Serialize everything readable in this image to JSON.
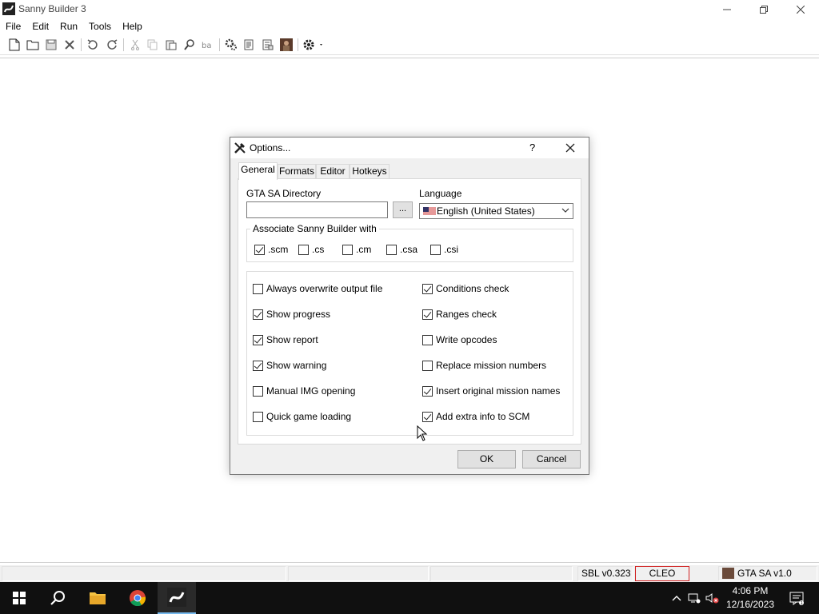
{
  "window": {
    "title": "Sanny Builder 3"
  },
  "menu": [
    "File",
    "Edit",
    "Run",
    "Tools",
    "Help"
  ],
  "status": {
    "sbl": "SBL v0.323",
    "cleo": "CLEO",
    "game": "GTA SA v1.0"
  },
  "dialog": {
    "title": "Options...",
    "help": "?",
    "tabs": [
      "General",
      "Formats",
      "Editor",
      "Hotkeys"
    ],
    "gta_dir_label": "GTA SA Directory",
    "gta_dir_value": "",
    "browse_label": "...",
    "language_label": "Language",
    "language_value": "English (United States)",
    "assoc_title": "Associate Sanny Builder with",
    "assoc": [
      {
        "label": ".scm",
        "checked": true
      },
      {
        "label": ".cs",
        "checked": false
      },
      {
        "label": ".cm",
        "checked": false
      },
      {
        "label": ".csa",
        "checked": false
      },
      {
        "label": ".csi",
        "checked": false
      }
    ],
    "options_left": [
      {
        "label": "Always overwrite output file",
        "checked": false
      },
      {
        "label": "Show progress",
        "checked": true
      },
      {
        "label": "Show report",
        "checked": true
      },
      {
        "label": "Show warning",
        "checked": true
      },
      {
        "label": "Manual IMG opening",
        "checked": false
      },
      {
        "label": "Quick game loading",
        "checked": false
      }
    ],
    "options_right": [
      {
        "label": "Conditions check",
        "checked": true
      },
      {
        "label": "Ranges check",
        "checked": true
      },
      {
        "label": "Write opcodes",
        "checked": false
      },
      {
        "label": "Replace mission numbers",
        "checked": false
      },
      {
        "label": "Insert original mission names",
        "checked": true
      },
      {
        "label": "Add extra info to SCM",
        "checked": true
      }
    ],
    "ok_label": "OK",
    "cancel_label": "Cancel"
  },
  "clock": {
    "time": "4:06 PM",
    "date": "12/16/2023"
  }
}
